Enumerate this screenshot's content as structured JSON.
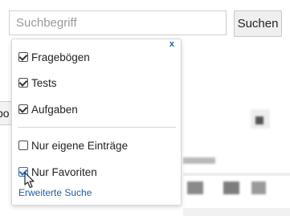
{
  "search": {
    "placeholder": "Suchbegriff",
    "value": "",
    "button_label": "Suchen"
  },
  "background": {
    "partial_button_label": "bo"
  },
  "dropdown": {
    "close_label": "x",
    "options": [
      {
        "label": "Fragebögen",
        "checked": true
      },
      {
        "label": "Tests",
        "checked": true
      },
      {
        "label": "Aufgaben",
        "checked": true
      }
    ],
    "filters": [
      {
        "label": "Nur eigene Einträge",
        "checked": false
      },
      {
        "label": "Nur Favoriten",
        "checked": true
      }
    ],
    "advanced_search_label": "Erweiterte Suche"
  },
  "colors": {
    "link": "#1f5fa8",
    "panel_border": "#d7d7d7",
    "button_bg": "#efefef"
  },
  "icons": {
    "cursor": "arrow-pointer-icon"
  }
}
